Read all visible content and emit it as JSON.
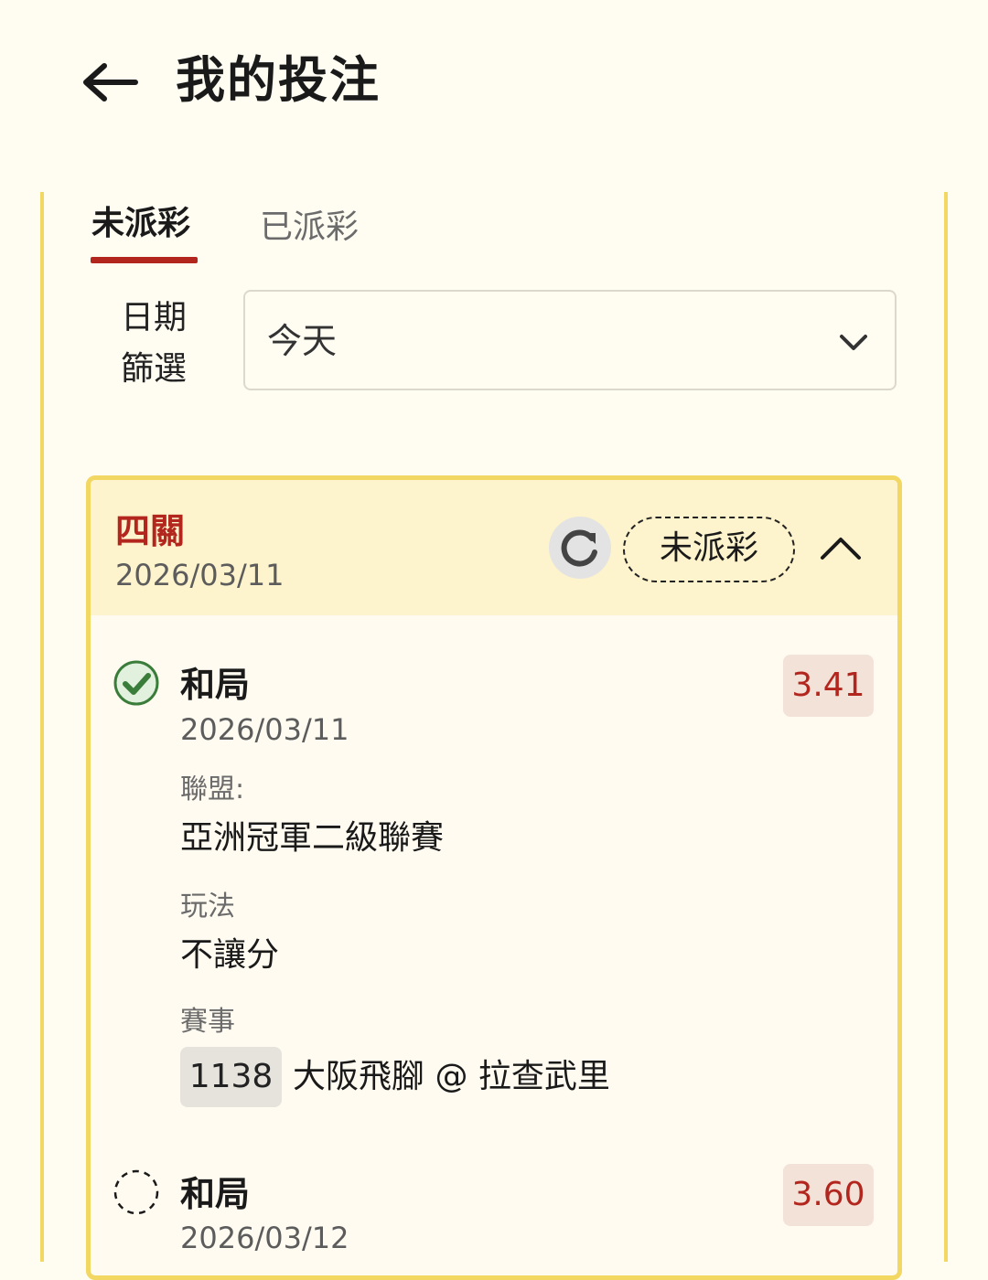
{
  "header": {
    "title": "我的投注",
    "back_icon": "arrow-left-icon"
  },
  "tabs": [
    {
      "label": "未派彩",
      "active": true
    },
    {
      "label": "已派彩",
      "active": false
    }
  ],
  "filter": {
    "label_line1": "日期",
    "label_line2": "篩選",
    "selected": "今天"
  },
  "bet": {
    "type": "四關",
    "date": "2026/03/11",
    "status": "未派彩",
    "legs": [
      {
        "result": "和局",
        "date": "2026/03/11",
        "odds": "3.41",
        "status": "checked",
        "league_label": "聯盟:",
        "league": "亞洲冠軍二級聯賽",
        "market_label": "玩法",
        "market": "不讓分",
        "event_label": "賽事",
        "event_code": "1138",
        "event_name": "大阪飛腳 @ 拉查武里"
      },
      {
        "result": "和局",
        "date": "2026/03/12",
        "odds": "3.60",
        "status": "pending"
      }
    ]
  },
  "colors": {
    "accent_red": "#b3261e",
    "card_border": "#f2d863",
    "header_bg": "#fdf3cc",
    "check_green": "#3a7d3a"
  }
}
